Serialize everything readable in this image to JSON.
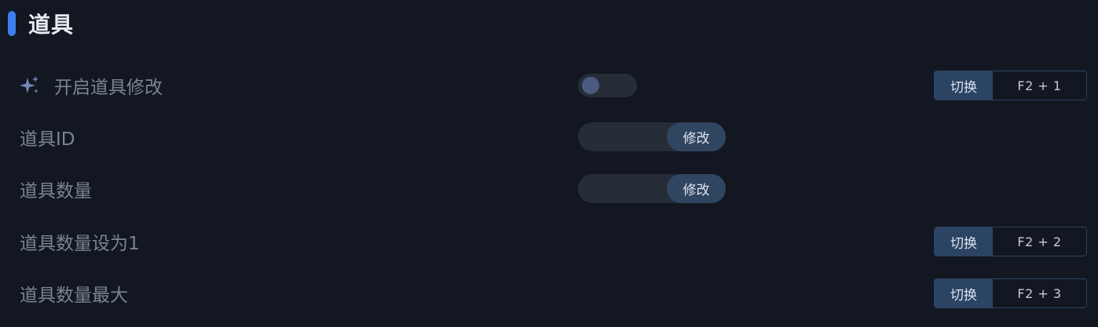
{
  "section": {
    "title": "道具"
  },
  "rows": [
    {
      "label": "开启道具修改",
      "icon": "sparkle-icon",
      "control": "toggle",
      "toggle_on": false,
      "hotkey": {
        "label": "切换",
        "keys": "F2 + 1"
      }
    },
    {
      "label": "道具ID",
      "control": "input",
      "input_value": "",
      "button_label": "修改"
    },
    {
      "label": "道具数量",
      "control": "input",
      "input_value": "",
      "button_label": "修改"
    },
    {
      "label": "道具数量设为1",
      "control": "none",
      "hotkey": {
        "label": "切换",
        "keys": "F2 + 2"
      }
    },
    {
      "label": "道具数量最大",
      "control": "none",
      "hotkey": {
        "label": "切换",
        "keys": "F2 + 3"
      }
    }
  ],
  "colors": {
    "background": "#121721",
    "accent": "#3f7df0",
    "button": "#304560",
    "hotkey_label_bg": "#2c4463",
    "text_muted": "#7a8494",
    "title": "#e7ebf1"
  }
}
